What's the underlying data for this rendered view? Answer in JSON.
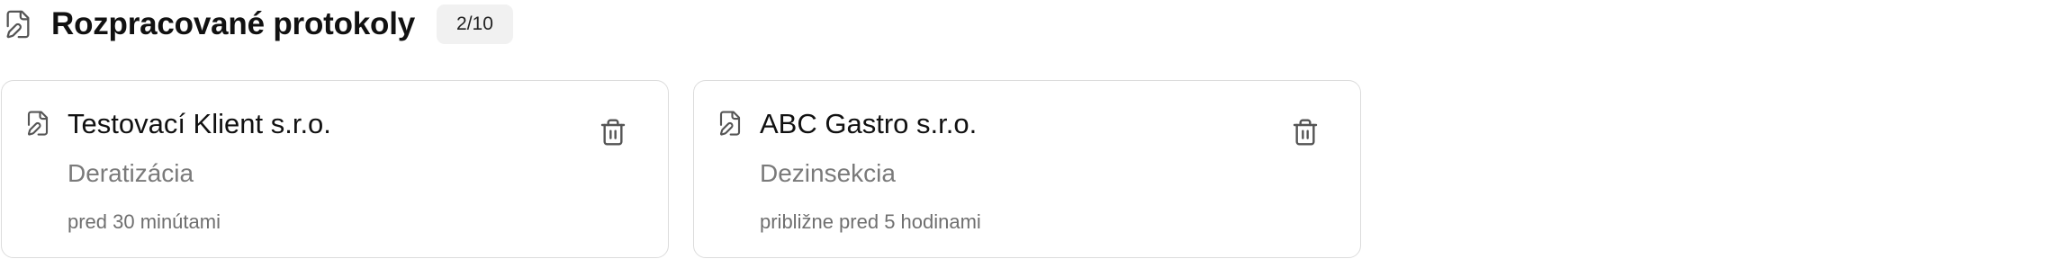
{
  "header": {
    "title": "Rozpracované protokoly",
    "count": "2/10",
    "icon": "file-pen-icon"
  },
  "protocols": [
    {
      "client": "Testovací Klient s.r.o.",
      "service": "Deratizácia",
      "time": "pred 30 minútami",
      "icon": "file-pen-icon",
      "delete_icon": "trash-icon"
    },
    {
      "client": "ABC Gastro s.r.o.",
      "service": "Dezinsekcia",
      "time": "približne pred 5 hodinami",
      "icon": "file-pen-icon",
      "delete_icon": "trash-icon"
    }
  ],
  "colors": {
    "text": "#111111",
    "muted": "#7a7a7a",
    "border": "#dcdcdc",
    "badge_bg": "#f1f1f1",
    "icon": "#555555"
  }
}
